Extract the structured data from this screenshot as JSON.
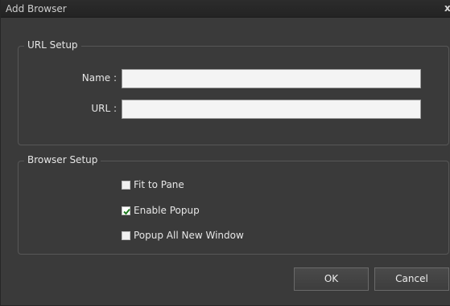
{
  "window": {
    "title": "Add Browser",
    "close_glyph": "x"
  },
  "url_setup": {
    "legend": "URL Setup",
    "name_label": "Name :",
    "name_value": "",
    "url_label": "URL :",
    "url_value": ""
  },
  "browser_setup": {
    "legend": "Browser Setup",
    "options": [
      {
        "label": "Fit to Pane",
        "checked": false
      },
      {
        "label": "Enable Popup",
        "checked": true
      },
      {
        "label": "Popup All New Window",
        "checked": false
      }
    ]
  },
  "buttons": {
    "ok": "OK",
    "cancel": "Cancel"
  },
  "colors": {
    "dialog_bg": "#3a3a3a",
    "checkmark": "#1e7a1e"
  }
}
